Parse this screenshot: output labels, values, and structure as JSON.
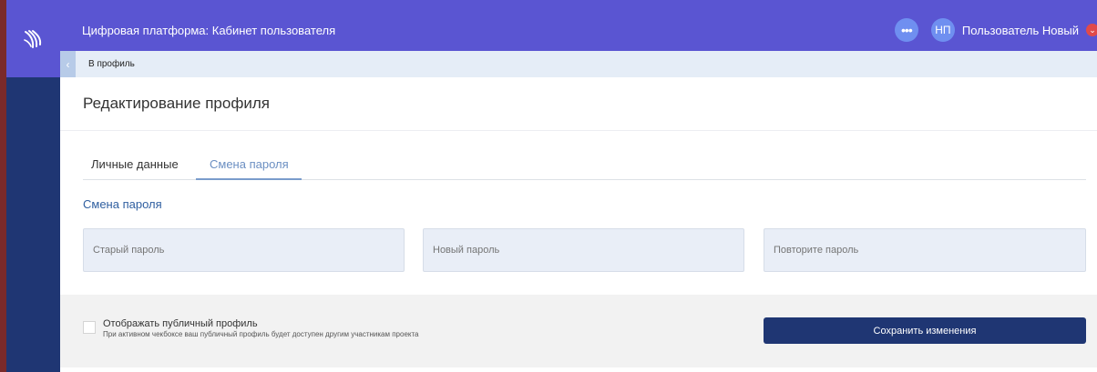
{
  "header": {
    "app_title": "Цифровая платформа: Кабинет пользователя",
    "more_icon": "more-dots-icon",
    "avatar_initials": "НП",
    "user_name": "Пользователь Новый",
    "user_badge_icon": "chevron-down-icon"
  },
  "breadcrumb": {
    "back_icon": "chevron-left-icon",
    "link_label": "В профиль"
  },
  "page": {
    "title": "Редактирование профиля"
  },
  "tabs": [
    {
      "label": "Личные данные",
      "active": false
    },
    {
      "label": "Смена пароля",
      "active": true
    }
  ],
  "password_section": {
    "title": "Смена пароля",
    "fields": [
      {
        "placeholder": "Старый пароль",
        "value": ""
      },
      {
        "placeholder": "Новый пароль",
        "value": ""
      },
      {
        "placeholder": "Повторите пароль",
        "value": ""
      }
    ]
  },
  "footer": {
    "public_profile_label": "Отображать публичный профиль",
    "public_profile_hint": "При активном чекбоксе ваш публичный профиль будет доступен другим участникам проекта",
    "public_profile_checked": false,
    "save_label": "Сохранить изменения"
  },
  "colors": {
    "header_bg": "#5a55d2",
    "rail_bg": "#1f3673",
    "accent_text": "#2f5fa0",
    "active_tab": "#6b8fc2",
    "save_button": "#1f3673"
  }
}
